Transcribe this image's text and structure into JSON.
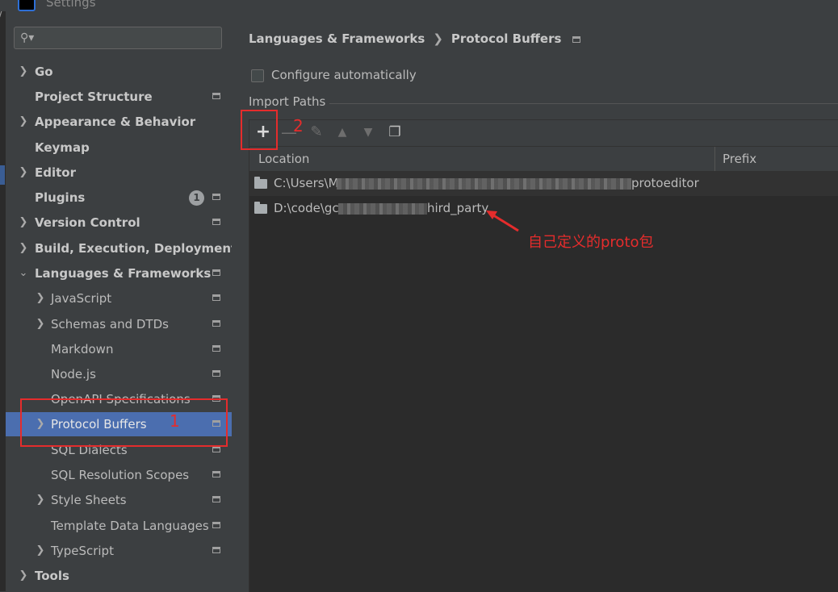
{
  "window": {
    "title": "Settings"
  },
  "search": {
    "placeholder": ""
  },
  "tree": [
    {
      "label": "Go",
      "chevron": "right",
      "bold": true,
      "indent": 0
    },
    {
      "label": "Project Structure",
      "chevron": "",
      "bold": true,
      "indent": 0,
      "project_icon": true
    },
    {
      "label": "Appearance & Behavior",
      "chevron": "right",
      "bold": true,
      "indent": 0
    },
    {
      "label": "Keymap",
      "chevron": "",
      "bold": true,
      "indent": 0
    },
    {
      "label": "Editor",
      "chevron": "right",
      "bold": true,
      "indent": 0
    },
    {
      "label": "Plugins",
      "chevron": "",
      "bold": true,
      "indent": 0,
      "badge": "1",
      "project_icon": true
    },
    {
      "label": "Version Control",
      "chevron": "right",
      "bold": true,
      "indent": 0,
      "project_icon": true
    },
    {
      "label": "Build, Execution, Deployment",
      "chevron": "right",
      "bold": true,
      "indent": 0
    },
    {
      "label": "Languages & Frameworks",
      "chevron": "down",
      "bold": true,
      "indent": 0,
      "project_icon": true
    },
    {
      "label": "JavaScript",
      "chevron": "right",
      "bold": false,
      "indent": 1,
      "project_icon": true
    },
    {
      "label": "Schemas and DTDs",
      "chevron": "right",
      "bold": false,
      "indent": 1,
      "project_icon": true
    },
    {
      "label": "Markdown",
      "chevron": "",
      "bold": false,
      "indent": 1,
      "project_icon": true
    },
    {
      "label": "Node.js",
      "chevron": "",
      "bold": false,
      "indent": 1,
      "project_icon": true
    },
    {
      "label": "OpenAPI Specifications",
      "chevron": "",
      "bold": false,
      "indent": 1,
      "project_icon": true
    },
    {
      "label": "Protocol Buffers",
      "chevron": "right",
      "bold": false,
      "indent": 1,
      "project_icon": true,
      "selected": true
    },
    {
      "label": "SQL Dialects",
      "chevron": "",
      "bold": false,
      "indent": 1,
      "project_icon": true
    },
    {
      "label": "SQL Resolution Scopes",
      "chevron": "",
      "bold": false,
      "indent": 1,
      "project_icon": true
    },
    {
      "label": "Style Sheets",
      "chevron": "right",
      "bold": false,
      "indent": 1,
      "project_icon": true
    },
    {
      "label": "Template Data Languages",
      "chevron": "",
      "bold": false,
      "indent": 1,
      "project_icon": true
    },
    {
      "label": "TypeScript",
      "chevron": "right",
      "bold": false,
      "indent": 1,
      "project_icon": true
    },
    {
      "label": "Tools",
      "chevron": "right",
      "bold": true,
      "indent": 0
    }
  ],
  "breadcrumb": {
    "parent": "Languages & Frameworks",
    "current": "Protocol Buffers"
  },
  "configure": {
    "label": "Configure automatically",
    "checked": false
  },
  "import_paths": {
    "section_label": "Import Paths",
    "columns": {
      "location": "Location",
      "prefix": "Prefix"
    },
    "rows": [
      {
        "start": "C:\\Users\\M",
        "end": "protoeditor"
      },
      {
        "start": "D:\\code\\gc",
        "end": "hird_party"
      }
    ]
  },
  "toolbar_icons": [
    "add-icon",
    "remove-icon",
    "edit-icon",
    "move-up-icon",
    "move-down-icon",
    "copy-icon"
  ],
  "annotations": {
    "step1": "1",
    "step2": "2",
    "note": "自己定义的proto包",
    "color": "#e52c2c"
  },
  "colors": {
    "background": "#3c3f41",
    "selection": "#4b6eaf",
    "table": "#2b2b2b"
  }
}
